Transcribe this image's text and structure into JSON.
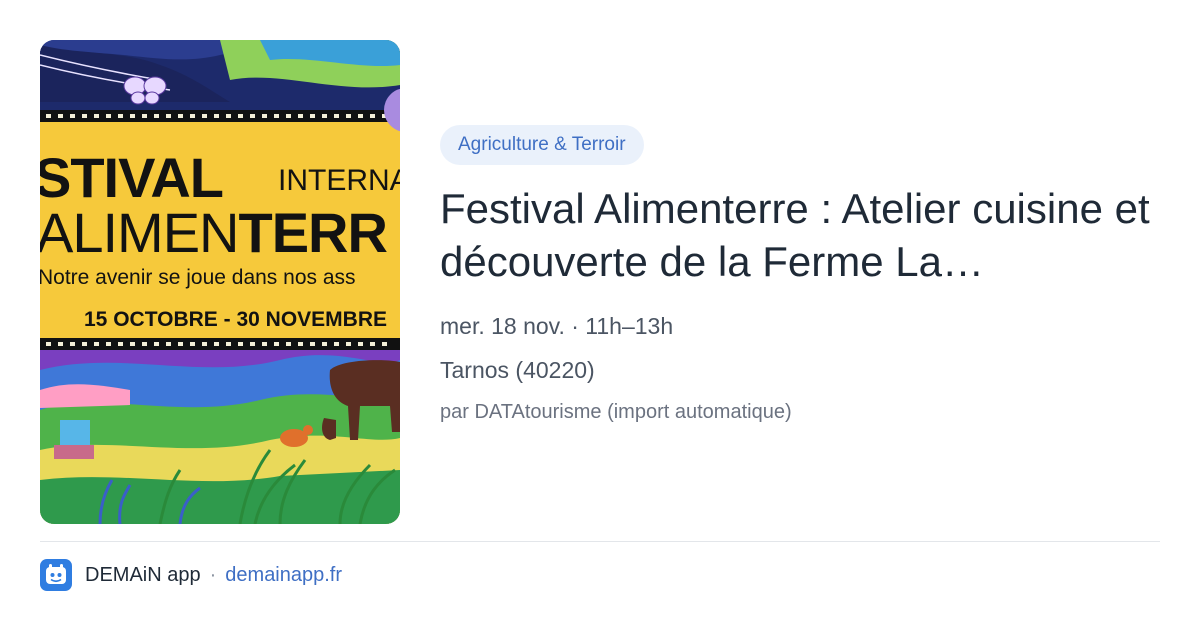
{
  "image": {
    "alt": "Festival Alimenterre poster",
    "line1": "STIVAL",
    "intl": "INTERNATI",
    "line2_light": "ALIMEN",
    "line2_bold": "TERR",
    "tagline": "Notre avenir se joue dans nos ass",
    "dates": "15 OCTOBRE - 30 NOVEMBRE"
  },
  "event": {
    "category": "Agriculture & Terroir",
    "title": "Festival Alimenterre : Atelier cuisine et découverte de la Ferme La…",
    "date_time": "mer. 18 nov. · 11h–13h",
    "location": "Tarnos (40220)",
    "source": "par DATAtourisme (import automatique)"
  },
  "footer": {
    "app_name": "DEMAiN app",
    "separator": "·",
    "link": "demainapp.fr",
    "icon": "app-logo-icon"
  },
  "colors": {
    "accent": "#3f6fc4",
    "badge_bg": "#eaf1fb",
    "app_icon": "#2f7de1"
  }
}
